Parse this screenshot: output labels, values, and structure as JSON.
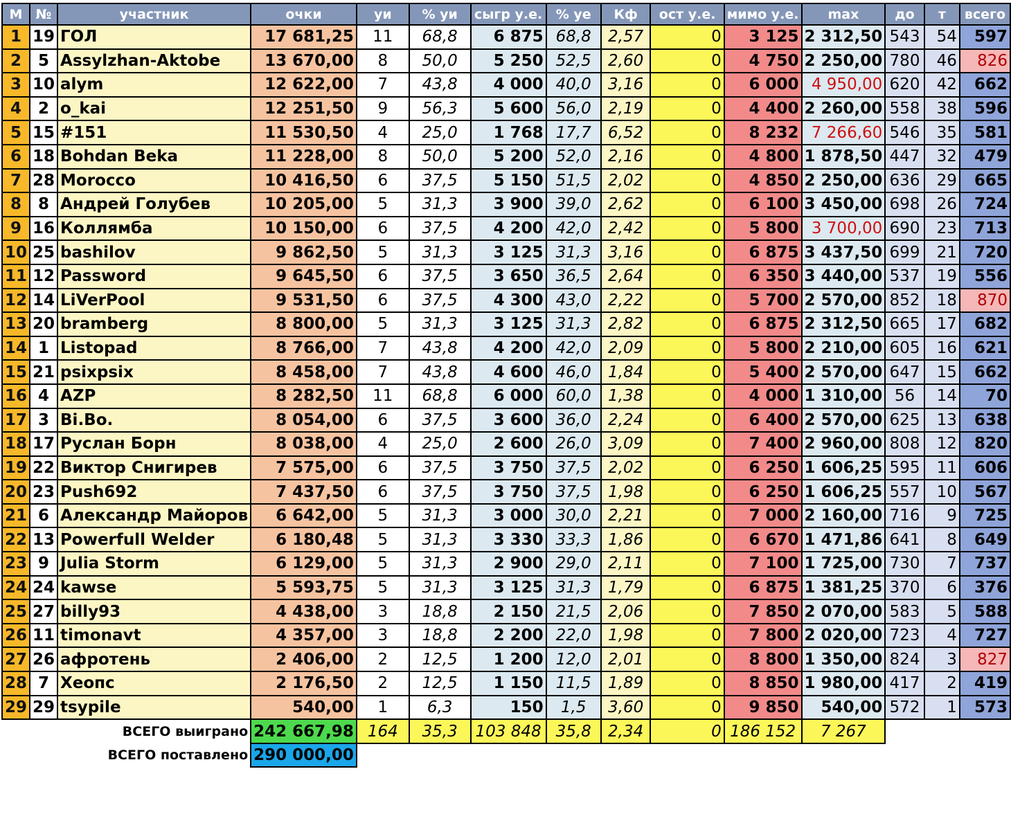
{
  "headers": [
    "М",
    "№",
    "участник",
    "очки",
    "уи",
    "% уи",
    "сыгр у.е.",
    "% уе",
    "Кф",
    "ост у.е.",
    "мимо у.е.",
    "max",
    "до",
    "т",
    "всего"
  ],
  "rows": [
    [
      "1",
      "19",
      "ГОЛ",
      "17 681,25",
      "11",
      "68,8",
      "6 875",
      "68,8",
      "2,57",
      "0",
      "3 125",
      "2 312,50",
      "543",
      "54",
      "597"
    ],
    [
      "2",
      "5",
      "Assylzhan-Aktobe",
      "13 670,00",
      "8",
      "50,0",
      "5 250",
      "52,5",
      "2,60",
      "0",
      "4 750",
      "2 250,00",
      "780",
      "46",
      "826"
    ],
    [
      "3",
      "10",
      "alym",
      "12 622,00",
      "7",
      "43,8",
      "4 000",
      "40,0",
      "3,16",
      "0",
      "6 000",
      "4 950,00",
      "620",
      "42",
      "662"
    ],
    [
      "4",
      "2",
      "o_kai",
      "12 251,50",
      "9",
      "56,3",
      "5 600",
      "56,0",
      "2,19",
      "0",
      "4 400",
      "2 260,00",
      "558",
      "38",
      "596"
    ],
    [
      "5",
      "15",
      "#151",
      "11 530,50",
      "4",
      "25,0",
      "1 768",
      "17,7",
      "6,52",
      "0",
      "8 232",
      "7 266,60",
      "546",
      "35",
      "581"
    ],
    [
      "6",
      "18",
      "Bohdan Beka",
      "11 228,00",
      "8",
      "50,0",
      "5 200",
      "52,0",
      "2,16",
      "0",
      "4 800",
      "1 878,50",
      "447",
      "32",
      "479"
    ],
    [
      "7",
      "28",
      "Morocco",
      "10 416,50",
      "6",
      "37,5",
      "5 150",
      "51,5",
      "2,02",
      "0",
      "4 850",
      "2 250,00",
      "636",
      "29",
      "665"
    ],
    [
      "8",
      "8",
      "Андрей Голубев",
      "10 205,00",
      "5",
      "31,3",
      "3 900",
      "39,0",
      "2,62",
      "0",
      "6 100",
      "3 450,00",
      "698",
      "26",
      "724"
    ],
    [
      "9",
      "16",
      "Коллямба",
      "10 150,00",
      "6",
      "37,5",
      "4 200",
      "42,0",
      "2,42",
      "0",
      "5 800",
      "3 700,00",
      "690",
      "23",
      "713"
    ],
    [
      "10",
      "25",
      "bashilov",
      "9 862,50",
      "5",
      "31,3",
      "3 125",
      "31,3",
      "3,16",
      "0",
      "6 875",
      "3 437,50",
      "699",
      "21",
      "720"
    ],
    [
      "11",
      "12",
      "Password",
      "9 645,50",
      "6",
      "37,5",
      "3 650",
      "36,5",
      "2,64",
      "0",
      "6 350",
      "3 440,00",
      "537",
      "19",
      "556"
    ],
    [
      "12",
      "14",
      "LiVerPool",
      "9 531,50",
      "6",
      "37,5",
      "4 300",
      "43,0",
      "2,22",
      "0",
      "5 700",
      "2 570,00",
      "852",
      "18",
      "870"
    ],
    [
      "13",
      "20",
      "bramberg",
      "8 800,00",
      "5",
      "31,3",
      "3 125",
      "31,3",
      "2,82",
      "0",
      "6 875",
      "2 312,50",
      "665",
      "17",
      "682"
    ],
    [
      "14",
      "1",
      "Listopad",
      "8 766,00",
      "7",
      "43,8",
      "4 200",
      "42,0",
      "2,09",
      "0",
      "5 800",
      "2 210,00",
      "605",
      "16",
      "621"
    ],
    [
      "15",
      "21",
      "psixpsix",
      "8 458,00",
      "7",
      "43,8",
      "4 600",
      "46,0",
      "1,84",
      "0",
      "5 400",
      "2 570,00",
      "647",
      "15",
      "662"
    ],
    [
      "16",
      "4",
      "AZP",
      "8 282,50",
      "11",
      "68,8",
      "6 000",
      "60,0",
      "1,38",
      "0",
      "4 000",
      "1 310,00",
      "56",
      "14",
      "70"
    ],
    [
      "17",
      "3",
      "Bi.Bo.",
      "8 054,00",
      "6",
      "37,5",
      "3 600",
      "36,0",
      "2,24",
      "0",
      "6 400",
      "2 570,00",
      "625",
      "13",
      "638"
    ],
    [
      "18",
      "17",
      "Руслан Борн",
      "8 038,00",
      "4",
      "25,0",
      "2 600",
      "26,0",
      "3,09",
      "0",
      "7 400",
      "2 960,00",
      "808",
      "12",
      "820"
    ],
    [
      "19",
      "22",
      "Виктор Снигирев",
      "7 575,00",
      "6",
      "37,5",
      "3 750",
      "37,5",
      "2,02",
      "0",
      "6 250",
      "1 606,25",
      "595",
      "11",
      "606"
    ],
    [
      "20",
      "23",
      "Push692",
      "7 437,50",
      "6",
      "37,5",
      "3 750",
      "37,5",
      "1,98",
      "0",
      "6 250",
      "1 606,25",
      "557",
      "10",
      "567"
    ],
    [
      "21",
      "6",
      "Александр Майоров",
      "6 642,00",
      "5",
      "31,3",
      "3 000",
      "30,0",
      "2,21",
      "0",
      "7 000",
      "2 160,00",
      "716",
      "9",
      "725"
    ],
    [
      "22",
      "13",
      "Powerfull Welder",
      "6 180,48",
      "5",
      "31,3",
      "3 330",
      "33,3",
      "1,86",
      "0",
      "6 670",
      "1 471,86",
      "641",
      "8",
      "649"
    ],
    [
      "23",
      "9",
      "Julia Storm",
      "6 129,00",
      "5",
      "31,3",
      "2 900",
      "29,0",
      "2,11",
      "0",
      "7 100",
      "1 725,00",
      "730",
      "7",
      "737"
    ],
    [
      "24",
      "24",
      "kawse",
      "5 593,75",
      "5",
      "31,3",
      "3 125",
      "31,3",
      "1,79",
      "0",
      "6 875",
      "1 381,25",
      "370",
      "6",
      "376"
    ],
    [
      "25",
      "27",
      "billy93",
      "4 438,00",
      "3",
      "18,8",
      "2 150",
      "21,5",
      "2,06",
      "0",
      "7 850",
      "2 070,00",
      "583",
      "5",
      "588"
    ],
    [
      "26",
      "11",
      "timonavt",
      "4 357,00",
      "3",
      "18,8",
      "2 200",
      "22,0",
      "1,98",
      "0",
      "7 800",
      "2 020,00",
      "723",
      "4",
      "727"
    ],
    [
      "27",
      "26",
      "афротень",
      "2 406,00",
      "2",
      "12,5",
      "1 200",
      "12,0",
      "2,01",
      "0",
      "8 800",
      "1 350,00",
      "824",
      "3",
      "827"
    ],
    [
      "28",
      "7",
      "Хеопс",
      "2 176,50",
      "2",
      "12,5",
      "1 150",
      "11,5",
      "1,89",
      "0",
      "8 850",
      "1 980,00",
      "417",
      "2",
      "419"
    ],
    [
      "29",
      "29",
      "tsypile",
      "540,00",
      "1",
      "6,3",
      "150",
      "1,5",
      "3,60",
      "0",
      "9 850",
      "540,00",
      "572",
      "1",
      "573"
    ]
  ],
  "highlight_max_rows": [
    2,
    4,
    8
  ],
  "highlight_total_rows": [
    1,
    11,
    26
  ],
  "totals": {
    "won_label": "ВСЕГО выиграно",
    "won_value": "242 667,98",
    "ui": "164",
    "pui": "35,3",
    "played": "103 848",
    "pye": "35,8",
    "kf": "2,34",
    "ost": "0",
    "miss": "186 152",
    "max": "7 267",
    "bet_label": "ВСЕГО поставлено",
    "bet_value": "290 000,00"
  }
}
